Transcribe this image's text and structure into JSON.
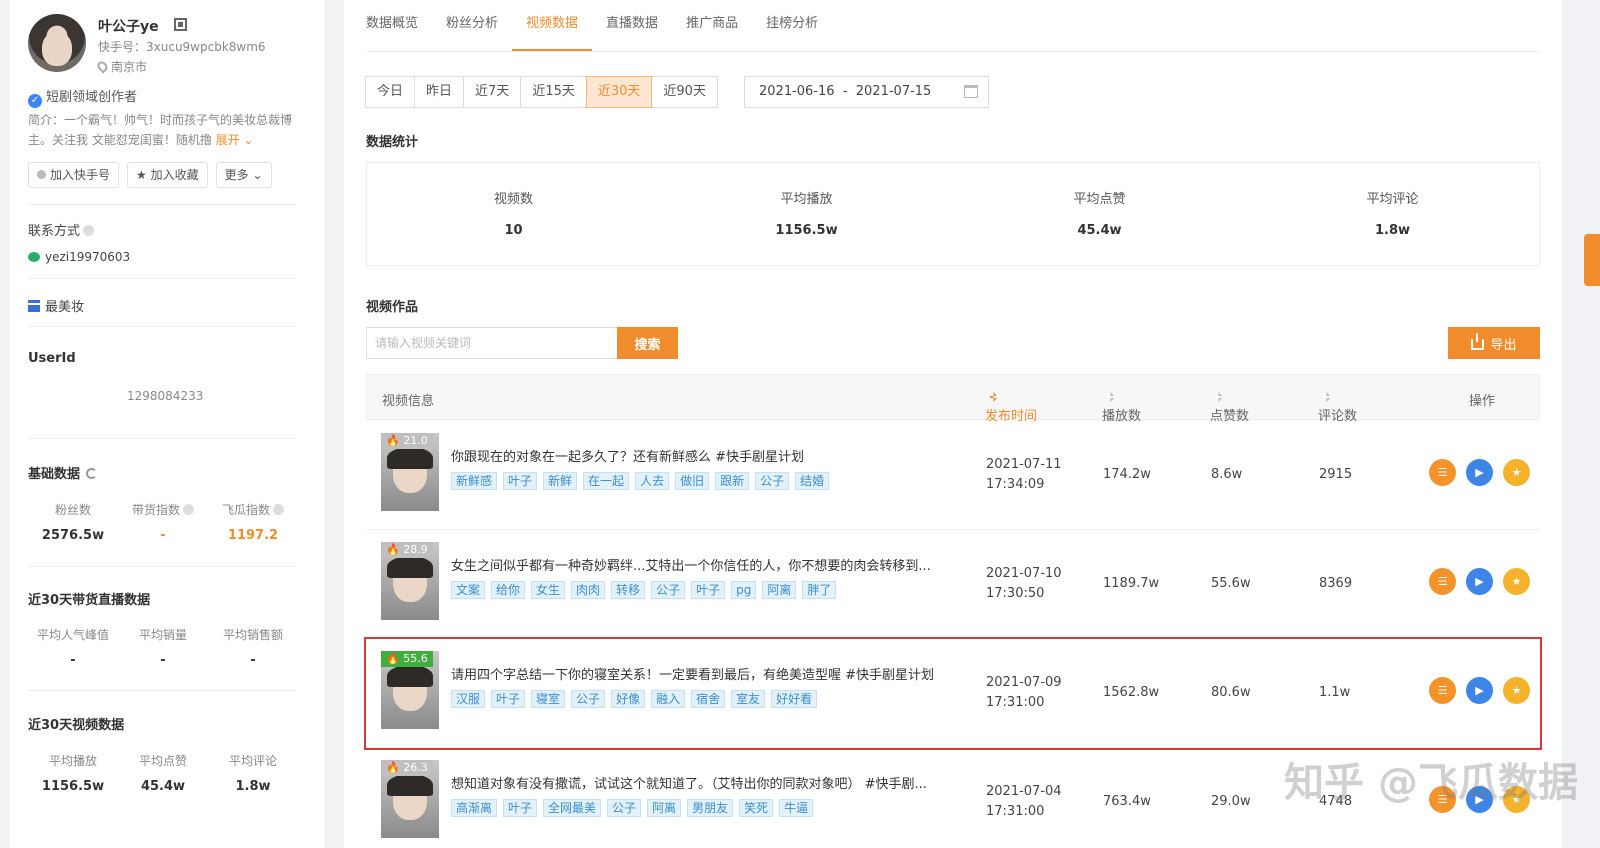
{
  "profile": {
    "name": "叶公子ye",
    "kuaishou_id": "快手号：3xucu9wpcbk8wm6",
    "location": "南京市",
    "verified": "短剧领域创作者",
    "bio": "简介：一个霸气！帅气！时而孩子气的美妆总裁博主。关注我 文能怼宠闺蜜！随机撸",
    "bio_expand": "展开",
    "buttons": {
      "add": "加入快手号",
      "favorite": "加入收藏",
      "more": "更多"
    }
  },
  "contact": {
    "label": "联系方式",
    "wechat": "yezi19970603"
  },
  "brand": "最美妆",
  "userid": {
    "label": "UserId",
    "value": "1298084233"
  },
  "basic": {
    "title": "基础数据",
    "items": [
      {
        "label": "粉丝数",
        "value": "2576.5w"
      },
      {
        "label": "带货指数",
        "value": "-"
      },
      {
        "label": "飞瓜指数",
        "value": "1197.2"
      }
    ]
  },
  "live30": {
    "title": "近30天带货直播数据",
    "items": [
      {
        "label": "平均人气峰值",
        "value": "-"
      },
      {
        "label": "平均销量",
        "value": "-"
      },
      {
        "label": "平均销售额",
        "value": "-"
      }
    ]
  },
  "video30": {
    "title": "近30天视频数据",
    "items": [
      {
        "label": "平均播放",
        "value": "1156.5w"
      },
      {
        "label": "平均点赞",
        "value": "45.4w"
      },
      {
        "label": "平均评论",
        "value": "1.8w"
      }
    ]
  },
  "tabs": [
    "数据概览",
    "粉丝分析",
    "视频数据",
    "直播数据",
    "推广商品",
    "挂榜分析"
  ],
  "ranges": [
    "今日",
    "昨日",
    "近7天",
    "近15天",
    "近30天",
    "近90天"
  ],
  "date_range": "2021-06-16  -  2021-07-15",
  "stats": {
    "title": "数据统计",
    "items": [
      {
        "label": "视频数",
        "value": "10"
      },
      {
        "label": "平均播放",
        "value": "1156.5w"
      },
      {
        "label": "平均点赞",
        "value": "45.4w"
      },
      {
        "label": "平均评论",
        "value": "1.8w"
      }
    ]
  },
  "works": {
    "title": "视频作品",
    "search_placeholder": "请输入视频关键词",
    "search_button": "搜索",
    "export_button": "导出"
  },
  "table": {
    "headers": {
      "info": "视频信息",
      "time": "发布时间",
      "plays": "播放数",
      "likes": "点赞数",
      "comments": "评论数",
      "ops": "操作"
    },
    "rows": [
      {
        "score": "21.0",
        "title": "你跟现在的对象在一起多久了？还有新鲜感么 #快手剧星计划",
        "tags": [
          "新鲜感",
          "叶子",
          "新鲜",
          "在一起",
          "人去",
          "做旧",
          "跟新",
          "公子",
          "结婚"
        ],
        "date": "2021-07-11",
        "time": "17:34:09",
        "plays": "174.2w",
        "likes": "8.6w",
        "comments": "2915"
      },
      {
        "score": "28.9",
        "title": "女生之间似乎都有一种奇妙羁绊...艾特出一个你信任的人，你不想要的肉会转移到...",
        "tags": [
          "文案",
          "给你",
          "女生",
          "肉肉",
          "转移",
          "公子",
          "叶子",
          "pg",
          "阿离",
          "胖了"
        ],
        "date": "2021-07-10",
        "time": "17:30:50",
        "plays": "1189.7w",
        "likes": "55.6w",
        "comments": "8369"
      },
      {
        "score": "55.6",
        "title": "请用四个字总结一下你的寝室关系！一定要看到最后，有绝美造型喔 #快手剧星计划",
        "tags": [
          "汉服",
          "叶子",
          "寝室",
          "公子",
          "好像",
          "融入",
          "宿舍",
          "室友",
          "好好看"
        ],
        "date": "2021-07-09",
        "time": "17:31:00",
        "plays": "1562.8w",
        "likes": "80.6w",
        "comments": "1.1w"
      },
      {
        "score": "26.3",
        "title": "想知道对象有没有撒谎，试试这个就知道了。（艾特出你的同款对象吧） #快手剧...",
        "tags": [
          "高渐离",
          "叶子",
          "全网最美",
          "公子",
          "阿离",
          "男朋友",
          "笑死",
          "牛逼"
        ],
        "date": "2021-07-04",
        "time": "17:31:00",
        "plays": "763.4w",
        "likes": "29.0w",
        "comments": "4748"
      }
    ]
  },
  "watermark": "知乎 @飞瓜数据",
  "colors": {
    "accent": "#f08c2b",
    "tag_text": "#3b8fcf",
    "highlight": "#d13b3b"
  }
}
